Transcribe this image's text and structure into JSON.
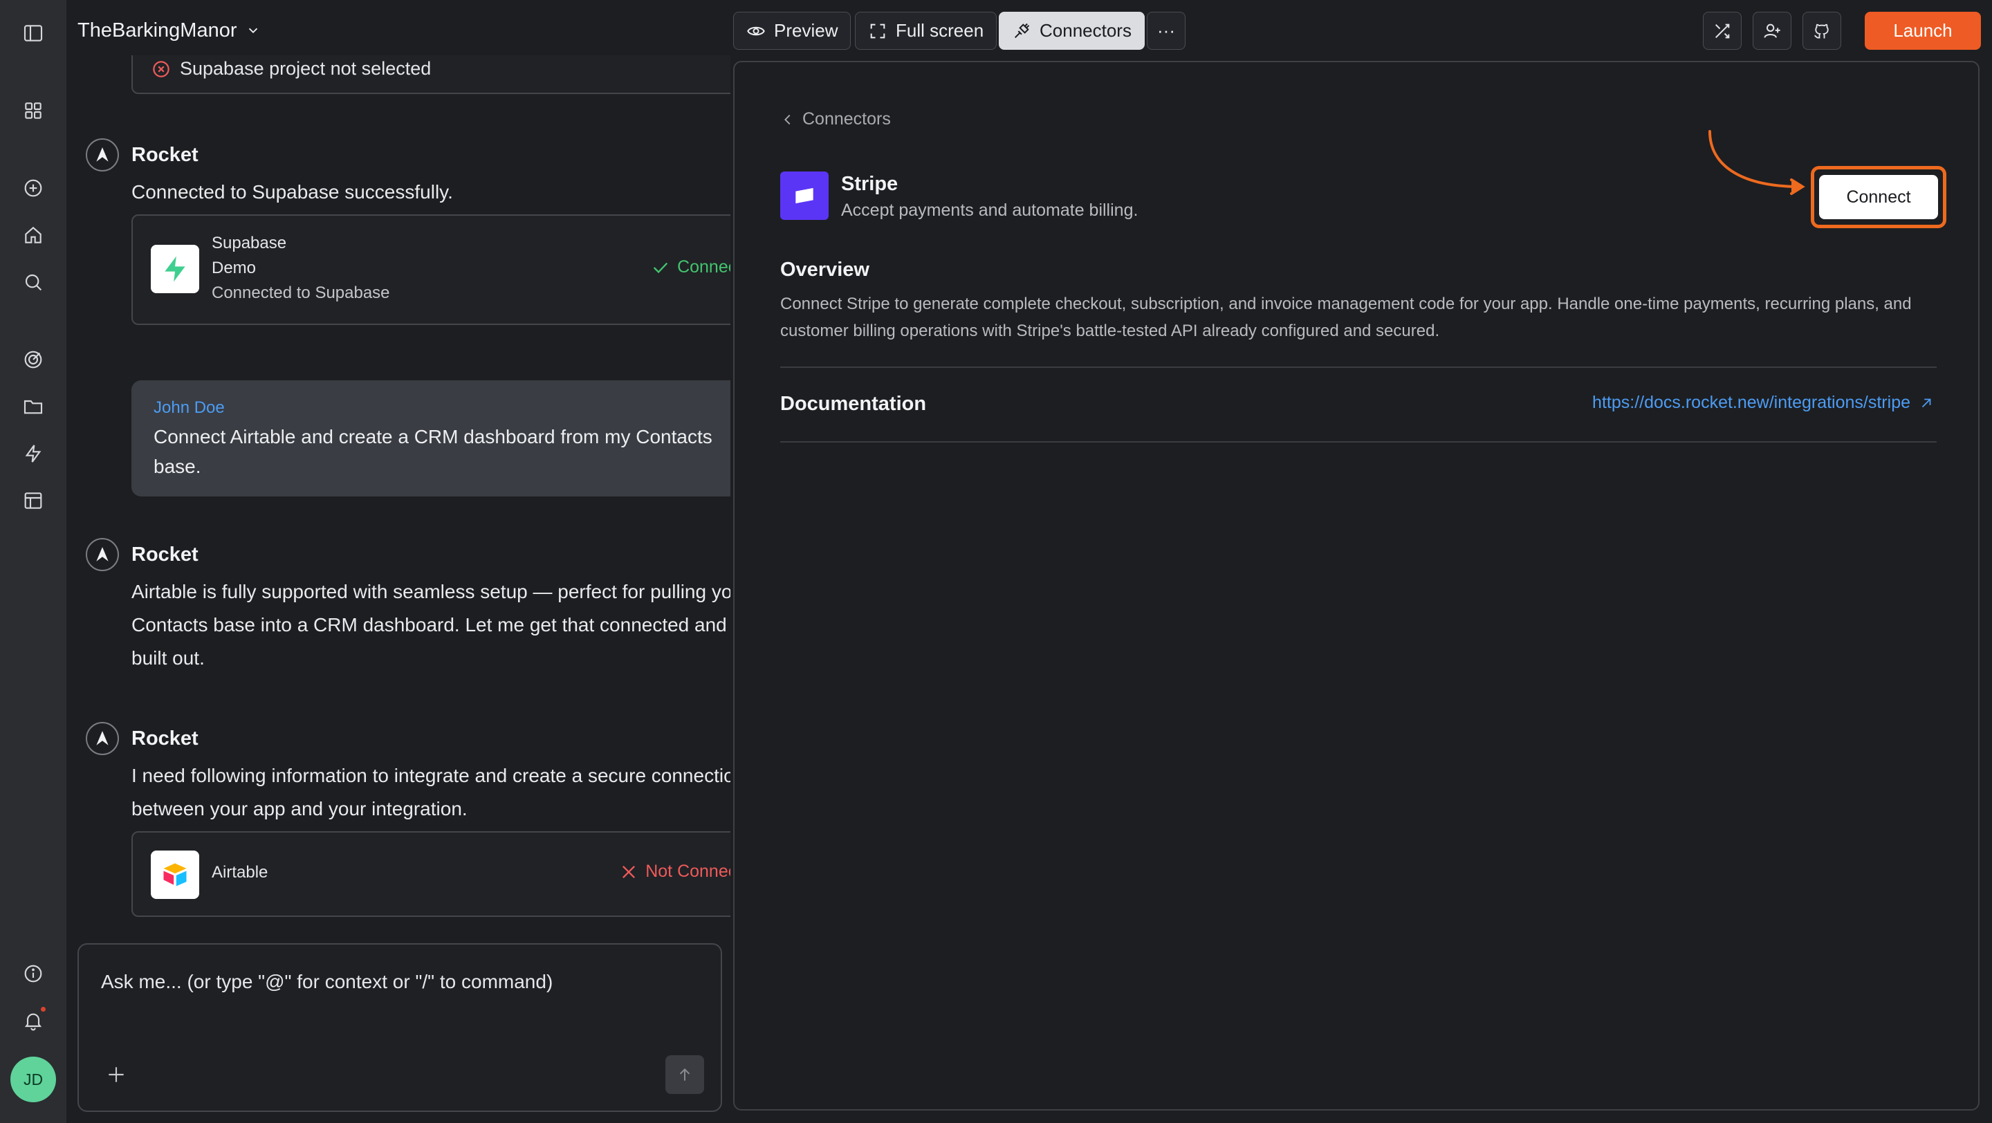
{
  "app": {
    "project_name": "TheBarkingManor"
  },
  "toolbar": {
    "preview_label": "Preview",
    "fullscreen_label": "Full screen",
    "connectors_label": "Connectors",
    "more_label": "···",
    "launch_label": "Launch"
  },
  "rail": {
    "icons": [
      "sidebar-toggle-icon",
      "grid-icon",
      "plus-circle-icon",
      "home-icon",
      "search-icon",
      "target-icon",
      "folder-icon",
      "bolt-icon",
      "layout-icon",
      "info-icon",
      "bell-icon"
    ],
    "avatar_initials": "JD"
  },
  "chat": {
    "top_card_text": "Supabase project not selected",
    "msg1": {
      "author": "Rocket",
      "text": "Connected to Supabase successfully.",
      "card": {
        "title": "Supabase",
        "subtitle": "Demo",
        "detail": "Connected to Supabase",
        "status": "Connected"
      }
    },
    "user_msg": {
      "author": "John Doe",
      "text": "Connect Airtable and create a CRM dashboard from my Contacts base."
    },
    "msg2": {
      "author": "Rocket",
      "text": "Airtable is fully supported with seamless setup — perfect for pulling your Contacts base into a CRM dashboard. Let me get that connected and built out."
    },
    "msg3": {
      "author": "Rocket",
      "text": "I need following information to integrate and create a secure connection between your app and your integration.",
      "card": {
        "title": "Airtable",
        "status": "Not Connected"
      }
    },
    "composer_placeholder": "Ask me... (or type \"@\" for context or \"/\" to command)"
  },
  "panel": {
    "back_label": "Connectors",
    "connector_name": "Stripe",
    "connector_desc": "Accept payments and automate billing.",
    "connect_label": "Connect",
    "overview_title": "Overview",
    "overview_text": "Connect Stripe to generate complete checkout, subscription, and invoice management code for your app. Handle one-time payments, recurring plans, and customer billing operations with Stripe's battle-tested API already configured and secured.",
    "documentation_title": "Documentation",
    "documentation_url": "https://docs.rocket.new/integrations/stripe"
  },
  "colors": {
    "accent_orange": "#ee5b24",
    "link_blue": "#4c9cf4",
    "success_green": "#43c46e",
    "error_red": "#ef5a5a",
    "stripe_purple": "#5b35f5"
  }
}
